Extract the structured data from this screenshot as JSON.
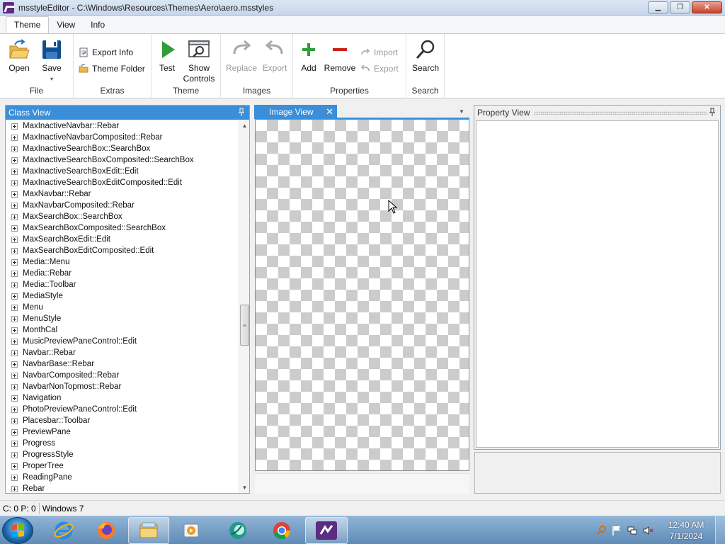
{
  "window": {
    "title": "msstyleEditor - C:\\Windows\\Resources\\Themes\\Aero\\aero.msstyles",
    "minimize_glyph": "▁",
    "maximize_glyph": "❐",
    "close_glyph": "✕"
  },
  "ribbon_tabs": [
    "Theme",
    "View",
    "Info"
  ],
  "ribbon": {
    "file": {
      "label": "File",
      "open": "Open",
      "save": "Save"
    },
    "extras": {
      "label": "Extras",
      "export_info": "Export Info",
      "theme_folder": "Theme Folder"
    },
    "theme": {
      "label": "Theme",
      "test": "Test",
      "show_controls": "Show Controls"
    },
    "images": {
      "label": "Images",
      "replace": "Replace",
      "export": "Export"
    },
    "properties": {
      "label": "Properties",
      "add": "Add",
      "remove": "Remove",
      "import": "Import",
      "export": "Export"
    },
    "search": {
      "label": "Search",
      "search": "Search"
    }
  },
  "class_view": {
    "title": "Class View",
    "items": [
      "MaxInactiveNavbar::Rebar",
      "MaxInactiveNavbarComposited::Rebar",
      "MaxInactiveSearchBox::SearchBox",
      "MaxInactiveSearchBoxComposited::SearchBox",
      "MaxInactiveSearchBoxEdit::Edit",
      "MaxInactiveSearchBoxEditComposited::Edit",
      "MaxNavbar::Rebar",
      "MaxNavbarComposited::Rebar",
      "MaxSearchBox::SearchBox",
      "MaxSearchBoxComposited::SearchBox",
      "MaxSearchBoxEdit::Edit",
      "MaxSearchBoxEditComposited::Edit",
      "Media::Menu",
      "Media::Rebar",
      "Media::Toolbar",
      "MediaStyle",
      "Menu",
      "MenuStyle",
      "MonthCal",
      "MusicPreviewPaneControl::Edit",
      "Navbar::Rebar",
      "NavbarBase::Rebar",
      "NavbarComposited::Rebar",
      "NavbarNonTopmost::Rebar",
      "Navigation",
      "PhotoPreviewPaneControl::Edit",
      "Placesbar::Toolbar",
      "PreviewPane",
      "Progress",
      "ProgressStyle",
      "ProperTree",
      "ReadingPane",
      "Rebar"
    ]
  },
  "image_view": {
    "title": "Image View",
    "close_glyph": "✕"
  },
  "property_view": {
    "title": "Property View"
  },
  "status": {
    "counts": "C: 0 P: 0",
    "platform": "Windows 7"
  },
  "clock": {
    "time": "12:40 AM",
    "date": "7/1/2024"
  },
  "colors": {
    "accent": "#3a8fd8",
    "green": "#2e9d3a",
    "red": "#c8201b",
    "save_blue": "#0f4f8f"
  }
}
